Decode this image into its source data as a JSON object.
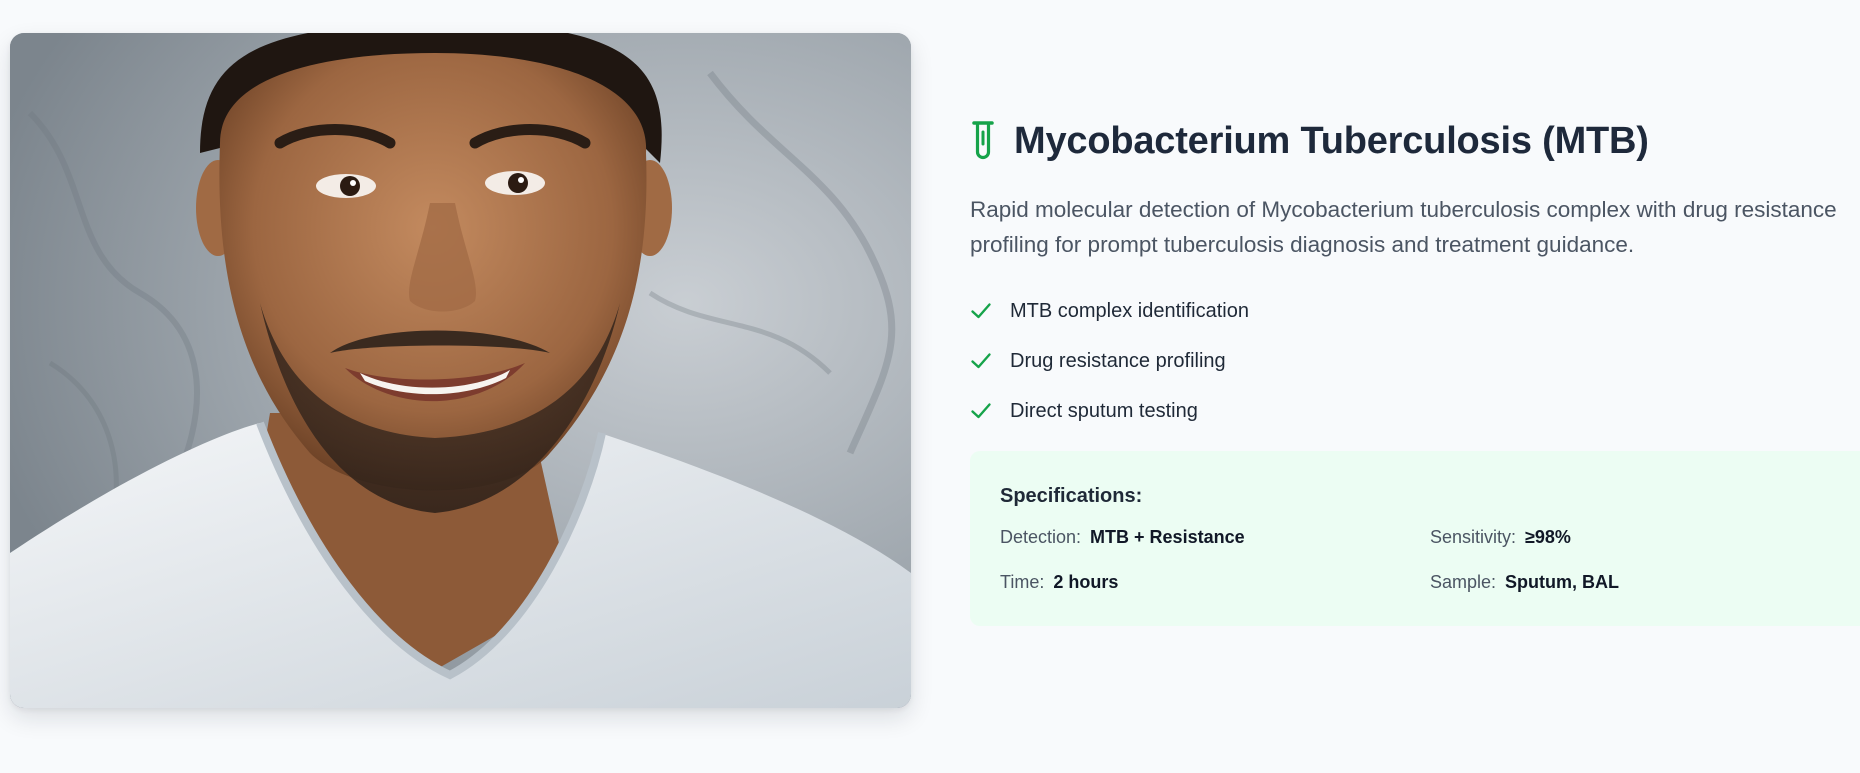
{
  "photo": {
    "alt": "Smiling man in white t-shirt"
  },
  "header": {
    "icon": "test-tube-icon",
    "title": "Mycobacterium Tuberculosis (MTB)"
  },
  "description": "Rapid molecular detection of Mycobacterium tuberculosis complex with drug resistance profiling for prompt tuberculosis diagnosis and treatment guidance.",
  "features": [
    {
      "icon": "check-icon",
      "label": "MTB complex identification"
    },
    {
      "icon": "check-icon",
      "label": "Drug resistance profiling"
    },
    {
      "icon": "check-icon",
      "label": "Direct sputum testing"
    }
  ],
  "specifications": {
    "title": "Specifications:",
    "items": [
      {
        "key": "Detection:",
        "value": "MTB + Resistance"
      },
      {
        "key": "Sensitivity:",
        "value": "≥98%"
      },
      {
        "key": "Time:",
        "value": "2 hours"
      },
      {
        "key": "Sample:",
        "value": "Sputum, BAL"
      }
    ]
  },
  "colors": {
    "accent": "#16a34a",
    "background": "#f8fafc",
    "specs_background": "#ecfdf3",
    "title": "#1e293b"
  }
}
